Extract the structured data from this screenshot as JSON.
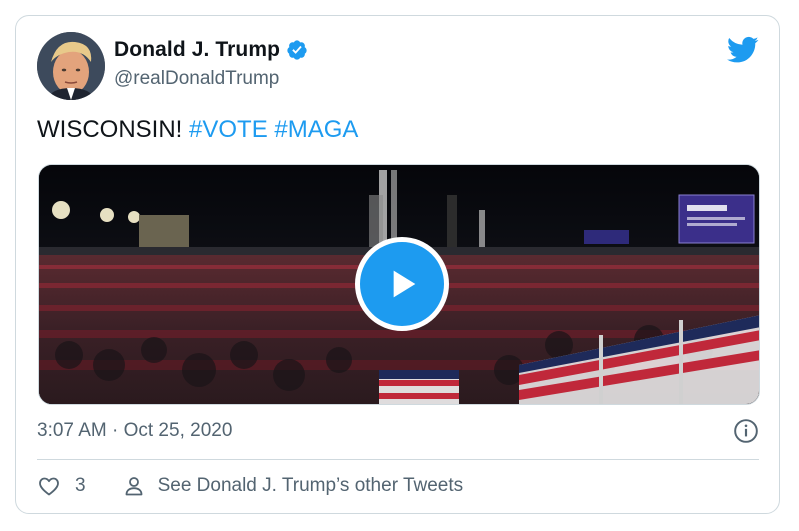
{
  "tweet": {
    "author": {
      "display_name": "Donald J. Trump",
      "handle": "@realDonaldTrump",
      "verified": true,
      "avatar_icon": "profile-photo"
    },
    "text_plain": "WISCONSIN! ",
    "hashtags": [
      "#VOTE",
      "#MAGA"
    ],
    "media": {
      "type": "video",
      "play_icon": "play-icon"
    },
    "timestamp": "3:07 AM · Oct 25, 2020",
    "likes": "3",
    "other_tweets_label": "See Donald J. Trump’s other Tweets"
  },
  "colors": {
    "accent": "#1d9bf0",
    "text_primary": "#0f1419",
    "text_secondary": "#536471",
    "border": "#cfd9de"
  },
  "icons": {
    "brand": "twitter-bird-icon",
    "verified": "verified-badge-icon",
    "info": "info-icon",
    "like": "heart-icon",
    "profile": "person-icon"
  }
}
